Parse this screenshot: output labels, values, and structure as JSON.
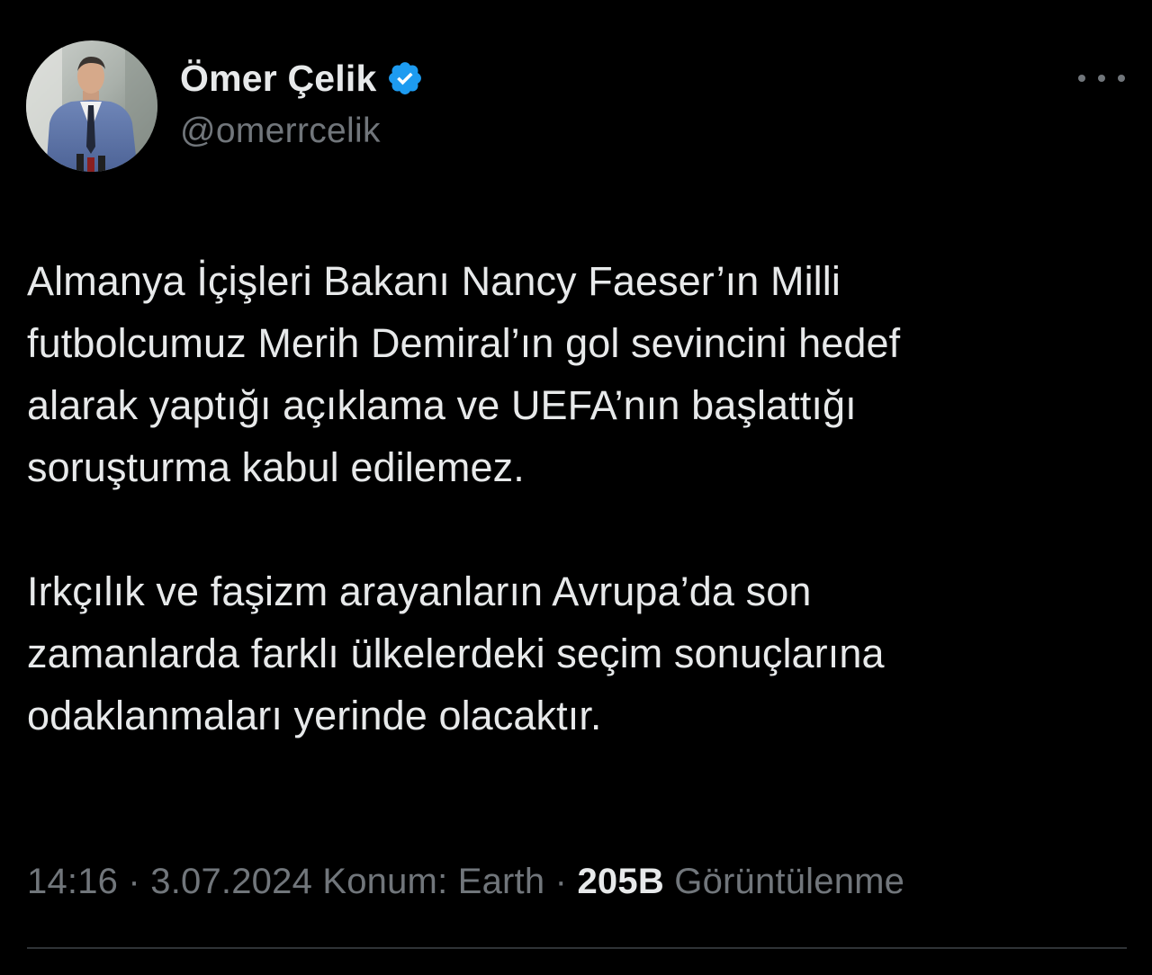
{
  "author": {
    "display_name": "Ömer Çelik",
    "handle": "@omerrcelik",
    "verified": true
  },
  "tweet": {
    "paragraphs": [
      [
        "Almanya İçişleri Bakanı Nancy Faeser’ın Milli",
        "futbolcumuz Merih Demiral’ın gol sevincini hedef",
        "alarak yaptığı açıklama ve UEFA’nın başlattığı",
        "soruşturma kabul edilemez."
      ],
      [
        "Irkçılık ve faşizm arayanların Avrupa’da son",
        "zamanlarda farklı ülkelerdeki seçim sonuçlarına",
        "odaklanmaları yerinde olacaktır."
      ]
    ]
  },
  "meta": {
    "time": "14:16",
    "separator": " · ",
    "date": "3.07.2024",
    "location": "Konum: Earth",
    "views_count": "205B",
    "views_label": "Görüntülenme"
  },
  "colors": {
    "background": "#000000",
    "text_primary": "#e7e9ea",
    "text_secondary": "#71767b",
    "verified_badge": "#1d9bf0",
    "divider": "#2f3336"
  },
  "icons": {
    "verified": "verified-badge-icon",
    "more": "more-options-icon"
  }
}
